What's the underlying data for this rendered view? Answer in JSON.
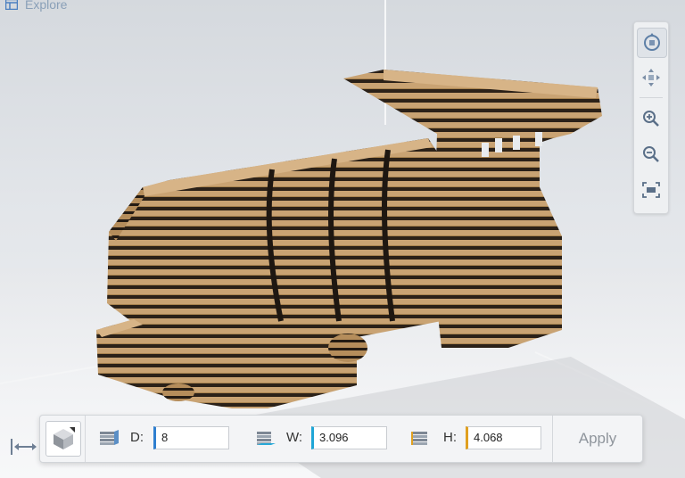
{
  "app": {
    "mode_label": "Explore",
    "mode_icon": "grid-icon"
  },
  "nav": {
    "buttons": [
      {
        "name": "orbit",
        "icon": "orbit-icon",
        "active": true
      },
      {
        "name": "pan",
        "icon": "pan-icon",
        "active": false
      },
      {
        "name": "zoom-in",
        "icon": "zoom-in-icon",
        "active": false
      },
      {
        "name": "zoom-out",
        "icon": "zoom-out-icon",
        "active": false
      },
      {
        "name": "fit",
        "icon": "fit-icon",
        "active": false
      }
    ]
  },
  "toolbar": {
    "dimensions": [
      {
        "label": "D:",
        "value": "8",
        "accent": "#2f7fd0"
      },
      {
        "label": "W:",
        "value": "3.096",
        "accent": "#1fa6d6"
      },
      {
        "label": "H:",
        "value": "4.068",
        "accent": "#e0a020"
      }
    ],
    "apply_label": "Apply"
  },
  "colors": {
    "cardboard": "#c9a373",
    "cardboard_dark": "#2b2118",
    "accent": "#2f7fd0"
  }
}
